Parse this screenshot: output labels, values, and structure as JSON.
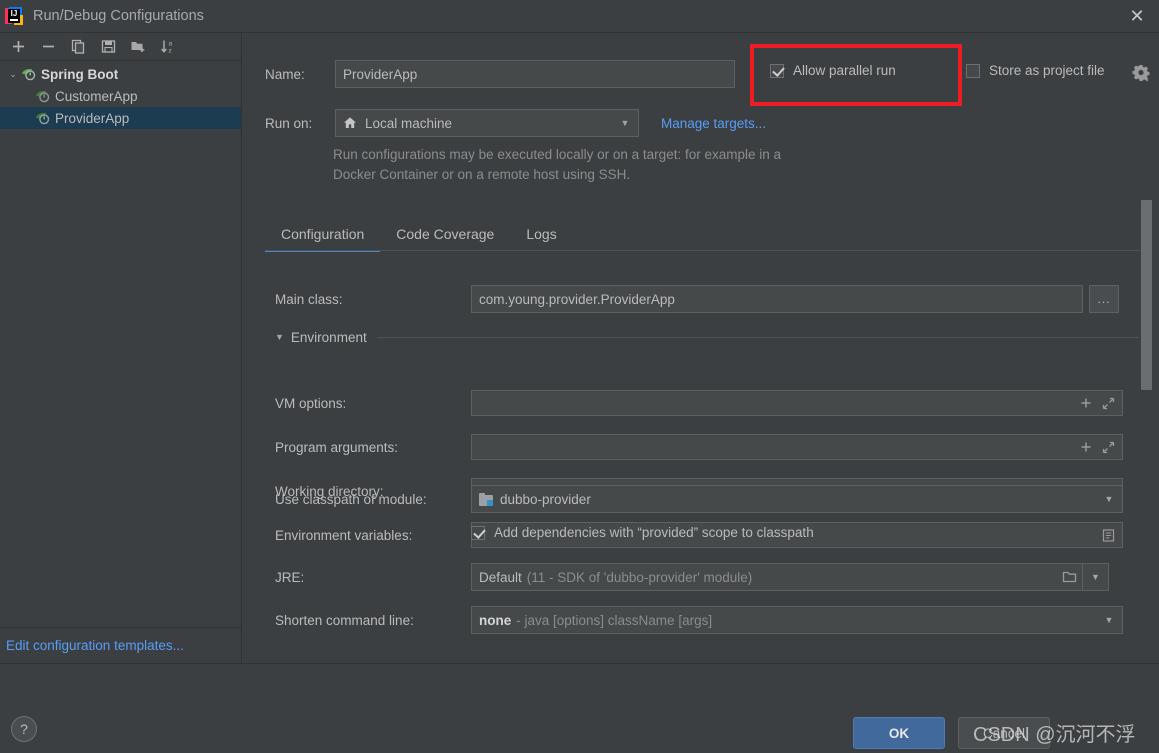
{
  "window": {
    "title": "Run/Debug Configurations",
    "logo_icon": "intellij-idea-logo",
    "close_icon": "close-icon",
    "close_glyph": "✕"
  },
  "toolbar": {
    "buttons": [
      {
        "name": "add-configuration-button",
        "icon": "plus-icon"
      },
      {
        "name": "remove-configuration-button",
        "icon": "minus-icon"
      },
      {
        "name": "copy-configuration-button",
        "icon": "copy-icon"
      },
      {
        "name": "save-configuration-button",
        "icon": "save-icon"
      },
      {
        "name": "new-folder-button",
        "icon": "new-folder-icon"
      },
      {
        "name": "sort-configurations-button",
        "icon": "sort-alphabetical-icon"
      }
    ]
  },
  "tree": {
    "group": {
      "label": "Spring Boot",
      "icon": "spring-boot-icon",
      "arrow": "⌄",
      "expanded": true
    },
    "items": [
      {
        "label": "CustomerApp",
        "icon": "spring-boot-icon",
        "selected": false
      },
      {
        "label": "ProviderApp",
        "icon": "spring-boot-icon",
        "selected": true
      }
    ],
    "edit_templates_link": "Edit configuration templates..."
  },
  "form": {
    "name_label": "Name:",
    "name_value": "ProviderApp",
    "name_placeholder": "",
    "run_on_label": "Run on:",
    "run_on_value": "Local machine",
    "run_on_icon": "home-icon",
    "manage_targets_link": "Manage targets...",
    "hint": "Run configurations may be executed locally or on a target: for example in a Docker Container or on a remote host using SSH."
  },
  "options": {
    "allow_parallel_run": {
      "label": "Allow parallel run",
      "checked": true
    },
    "store_as_project_file": {
      "label": "Store as project file",
      "checked": false
    },
    "gear_icon": "gear-dropdown-icon"
  },
  "highlight": {
    "color": "#ee1c25",
    "target": "allow-parallel-run-checkbox"
  },
  "tabs": [
    {
      "label": "Configuration",
      "active": true
    },
    {
      "label": "Code Coverage",
      "active": false
    },
    {
      "label": "Logs",
      "active": false
    }
  ],
  "configuration": {
    "main_class_label": "Main class:",
    "main_class_value": "com.young.provider.ProviderApp",
    "main_class_browse": "...",
    "environment_section": {
      "label": "Environment",
      "triangle": "▼",
      "expanded": true
    },
    "vm_options_label": "VM options:",
    "vm_options_value": "",
    "program_arguments_label": "Program arguments:",
    "program_arguments_value": "",
    "working_directory_label": "Working directory:",
    "working_directory_value": "",
    "environment_variables_label": "Environment variables:",
    "environment_variables_value": "",
    "use_classpath_label": "Use classpath of module:",
    "use_classpath_value": "dubbo-provider",
    "use_classpath_icon": "module-icon",
    "add_dependencies": {
      "label": "Add dependencies with “provided” scope to classpath",
      "checked": true
    },
    "jre_label": "JRE:",
    "jre_value": "Default",
    "jre_detail": "(11 - SDK of 'dubbo-provider' module)",
    "shorten_label": "Shorten command line:",
    "shorten_value": "none",
    "shorten_detail": "- java [options] className [args]"
  },
  "field_icons": {
    "expand": "expand-icon",
    "insert_macro": "plus-icon",
    "folder": "folder-icon",
    "list": "list-icon"
  },
  "scrollbar": {
    "name": "vertical-scrollbar"
  },
  "footer": {
    "help_label": "?",
    "ok_label": "OK",
    "cancel_label": "Cancel"
  },
  "watermark": {
    "text": "CSDN @沉河不浮"
  }
}
